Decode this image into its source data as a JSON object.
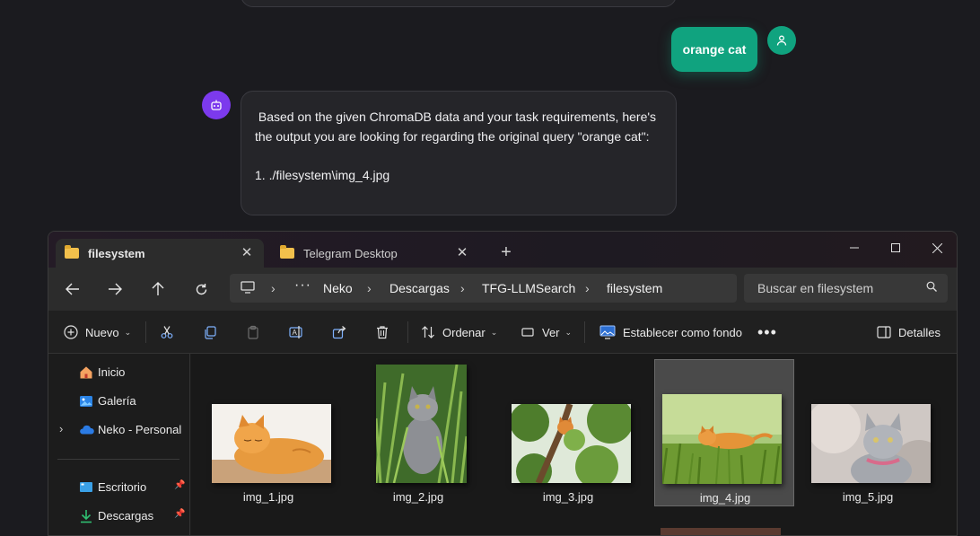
{
  "chat": {
    "user_message": "orange cat",
    "bot_message": " Based on the given ChromaDB data and your task requirements, here's the output you are looking for regarding the original query \"orange cat\":\n\n1. ./filesystem\\img_4.jpg"
  },
  "explorer": {
    "tabs": [
      {
        "label": "filesystem",
        "active": true
      },
      {
        "label": "Telegram Desktop",
        "active": false
      }
    ],
    "breadcrumb": [
      "Neko",
      "Descargas",
      "TFG-LLMSearch",
      "filesystem"
    ],
    "search_placeholder": "Buscar en filesystem",
    "toolbar": {
      "new_label": "Nuevo",
      "sort_label": "Ordenar",
      "view_label": "Ver",
      "set_background_label": "Establecer como fondo",
      "details_label": "Detalles"
    },
    "sidebar": {
      "home": "Inicio",
      "gallery": "Galería",
      "onedrive": "Neko - Personal",
      "desktop": "Escritorio",
      "downloads": "Descargas"
    },
    "files": [
      {
        "name": "img_1.jpg",
        "selected": false
      },
      {
        "name": "img_2.jpg",
        "selected": false
      },
      {
        "name": "img_3.jpg",
        "selected": false
      },
      {
        "name": "img_4.jpg",
        "selected": true
      },
      {
        "name": "img_5.jpg",
        "selected": false
      }
    ]
  },
  "colors": {
    "user_bubble": "#10a37f",
    "bot_avatar": "#7c3aed",
    "folder": "#f2c04c"
  }
}
